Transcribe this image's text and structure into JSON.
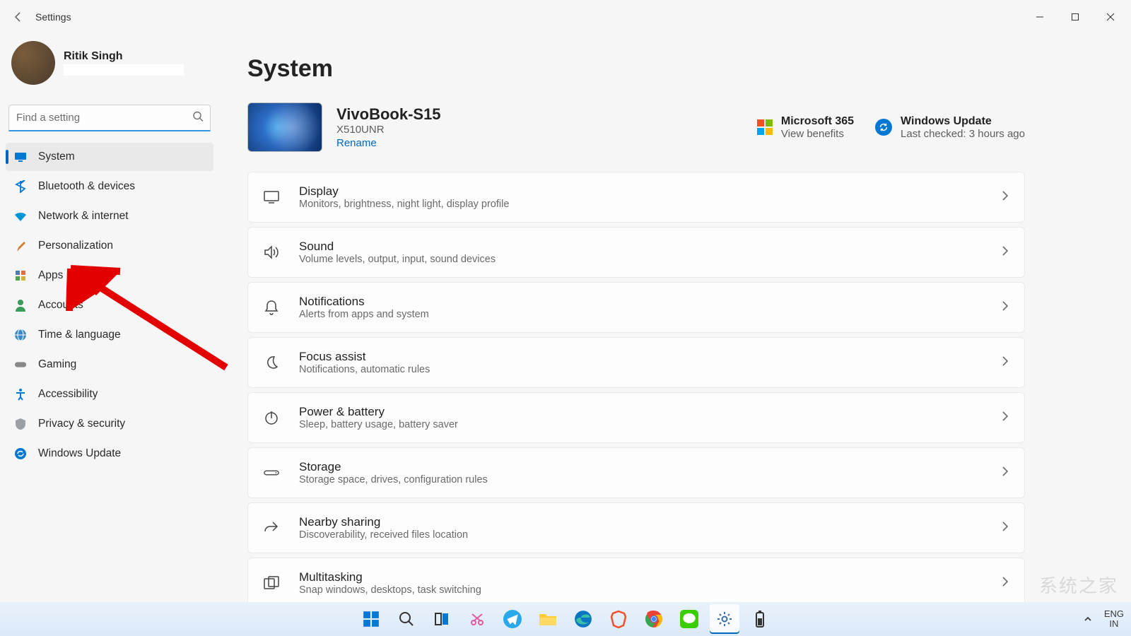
{
  "window": {
    "title": "Settings"
  },
  "user": {
    "name": "Ritik Singh"
  },
  "search": {
    "placeholder": "Find a setting"
  },
  "sidebar": {
    "items": [
      {
        "label": "System",
        "icon": "monitor-icon",
        "active": true
      },
      {
        "label": "Bluetooth & devices",
        "icon": "bluetooth-icon"
      },
      {
        "label": "Network & internet",
        "icon": "wifi-icon"
      },
      {
        "label": "Personalization",
        "icon": "brush-icon"
      },
      {
        "label": "Apps",
        "icon": "apps-icon"
      },
      {
        "label": "Accounts",
        "icon": "person-icon"
      },
      {
        "label": "Time & language",
        "icon": "globe-icon"
      },
      {
        "label": "Gaming",
        "icon": "gamepad-icon"
      },
      {
        "label": "Accessibility",
        "icon": "accessibility-icon"
      },
      {
        "label": "Privacy & security",
        "icon": "shield-icon"
      },
      {
        "label": "Windows Update",
        "icon": "update-icon"
      }
    ]
  },
  "page": {
    "title": "System"
  },
  "device": {
    "name": "VivoBook-S15",
    "model": "X510UNR",
    "rename": "Rename"
  },
  "status": {
    "ms365": {
      "title": "Microsoft 365",
      "sub": "View benefits"
    },
    "update": {
      "title": "Windows Update",
      "sub": "Last checked: 3 hours ago"
    }
  },
  "cards": [
    {
      "title": "Display",
      "sub": "Monitors, brightness, night light, display profile",
      "icon": "display"
    },
    {
      "title": "Sound",
      "sub": "Volume levels, output, input, sound devices",
      "icon": "sound"
    },
    {
      "title": "Notifications",
      "sub": "Alerts from apps and system",
      "icon": "bell"
    },
    {
      "title": "Focus assist",
      "sub": "Notifications, automatic rules",
      "icon": "moon"
    },
    {
      "title": "Power & battery",
      "sub": "Sleep, battery usage, battery saver",
      "icon": "power"
    },
    {
      "title": "Storage",
      "sub": "Storage space, drives, configuration rules",
      "icon": "storage"
    },
    {
      "title": "Nearby sharing",
      "sub": "Discoverability, received files location",
      "icon": "share"
    },
    {
      "title": "Multitasking",
      "sub": "Snap windows, desktops, task switching",
      "icon": "multitask"
    }
  ],
  "tray": {
    "lang1": "ENG",
    "lang2": "IN"
  },
  "watermark": "系统之家"
}
